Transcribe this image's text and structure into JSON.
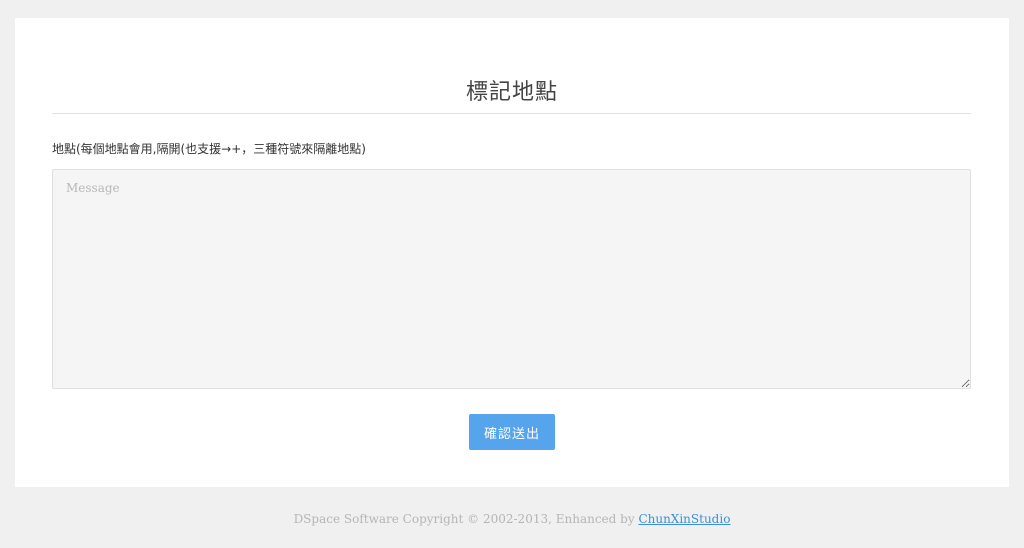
{
  "form": {
    "title": "標記地點",
    "field_label": "地點(每個地點會用,隔開(也支援→+，三種符號來隔離地點)",
    "message_value": "",
    "message_placeholder": "Message",
    "submit_label": "確認送出"
  },
  "footer": {
    "text": "DSpace Software Copyright © 2002-2013, Enhanced by",
    "link_label": "ChunXinStudio"
  },
  "colors": {
    "page_background": "#f0f0f0",
    "card_background": "#ffffff",
    "button_accent": "#56a5ec",
    "link": "#3b8fd8"
  }
}
